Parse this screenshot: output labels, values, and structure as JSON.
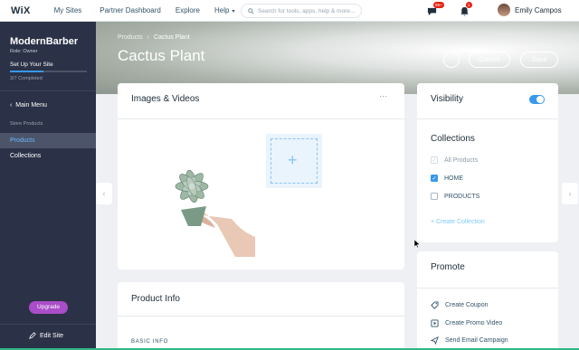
{
  "topbar": {
    "logo": "WiX",
    "nav": [
      "My Sites",
      "Partner Dashboard",
      "Explore",
      "Help"
    ],
    "search_placeholder": "Search for tools, apps, help & more...",
    "chat_badge": "99+",
    "notif_badge": "1",
    "user_name": "Emily Campos"
  },
  "sidebar": {
    "site_name": "ModernBarber",
    "role": "Role: Owner",
    "setup": "Set Up Your Site",
    "progress": 0.43,
    "completed": "3/7 Completed",
    "main_menu": "Main Menu",
    "section": "Store Products",
    "items": [
      {
        "label": "Products",
        "active": true
      },
      {
        "label": "Collections",
        "active": false
      }
    ],
    "upgrade": "Upgrade",
    "edit_site": "Edit Site"
  },
  "header": {
    "breadcrumb": [
      "Products",
      "Cactus Plant"
    ],
    "title": "Cactus Plant",
    "more": "···",
    "cancel": "Cancel",
    "save": "Save"
  },
  "images": {
    "title": "Images & Videos",
    "more": "···"
  },
  "product_info": {
    "title": "Product Info",
    "basic": "BASIC INFO"
  },
  "visibility": {
    "title": "Visibility",
    "enabled": true
  },
  "collections": {
    "title": "Collections",
    "items": [
      {
        "label": "All Products",
        "state": "disabled"
      },
      {
        "label": "HOME",
        "state": "checked"
      },
      {
        "label": "PRODUCTS",
        "state": "unchecked"
      }
    ],
    "create": "+ Create Collection"
  },
  "promote": {
    "title": "Promote",
    "items": [
      {
        "label": "Create Coupon",
        "icon": "tag-icon"
      },
      {
        "label": "Create Promo Video",
        "icon": "video-icon"
      },
      {
        "label": "Send Email Campaign",
        "icon": "send-icon"
      }
    ]
  },
  "colors": {
    "sidebar": "#2b3247",
    "accent": "#3899ec",
    "upgrade": "#aa4dc8"
  }
}
